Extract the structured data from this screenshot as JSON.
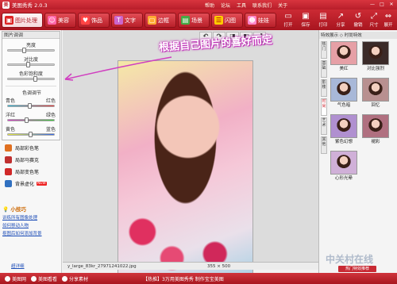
{
  "window": {
    "title": "美图秀秀 2.0.3",
    "menu": [
      "帮助",
      "论坛",
      "工具",
      "联系我们",
      "关于"
    ]
  },
  "tabs": [
    {
      "label": "图片处理",
      "active": true
    },
    {
      "label": "美容",
      "active": false
    },
    {
      "label": "饰品",
      "active": false
    },
    {
      "label": "文字",
      "active": false
    },
    {
      "label": "边框",
      "active": false
    },
    {
      "label": "场景",
      "active": false
    },
    {
      "label": "闪图",
      "active": false
    },
    {
      "label": "娃娃",
      "active": false
    }
  ],
  "toolbar": {
    "open": "打开",
    "save": "保存",
    "print": "打印",
    "share": "分享",
    "revert": "撤销",
    "resize": "尺寸",
    "expand": "展开"
  },
  "left_panel": {
    "adjust_title": "图片调调",
    "brightness": "亮度",
    "brightness_value": 0.35,
    "contrast": "对比度",
    "contrast_value": 0.45,
    "saturation": "色彩饱和度",
    "saturation_value": 0.62,
    "sharpness_title": "色调调节",
    "color_left_1": "青色",
    "color_right_1": "红色",
    "color_value_1": 0.48,
    "color_left_2": "洋红",
    "color_right_2": "绿色",
    "color_value_2": 0.4,
    "color_left_3": "黄色",
    "color_right_3": "蓝色",
    "color_value_3": 0.5,
    "effects": [
      {
        "label": "局部彩色笔",
        "new": false,
        "color": "#e07020"
      },
      {
        "label": "局部马赛克",
        "new": false,
        "color": "#c03030"
      },
      {
        "label": "局部变色笔",
        "new": false,
        "color": "#d02828"
      },
      {
        "label": "背景虚化",
        "new": true,
        "new_label": "NEW",
        "color": "#3070c0"
      }
    ],
    "tips_title": "小技巧",
    "tips": [
      "训练所有图像处理",
      "如何移动人物",
      "抠图后如何添加背景"
    ],
    "help_link": "超详细"
  },
  "canvas": {
    "tools": [
      "撤销",
      "重做",
      "原图",
      "对比",
      "预览"
    ],
    "tool_icons": [
      "undo-icon",
      "redo-icon",
      "original-icon",
      "compare-icon",
      "preview-icon"
    ],
    "filename": "y_large_83kr_27971241022.jpg",
    "dimensions": "355 × 500",
    "annotation": "根据自己图片的喜好而定"
  },
  "right_panel": {
    "header": "特效展示 ◇ 时尚特效",
    "vtabs": [
      "热门",
      "基础",
      "影楼",
      "时尚",
      "艺术",
      "其他"
    ],
    "active_vtab": 3,
    "effects": [
      {
        "label": "美红",
        "color": "#e6a0a6"
      },
      {
        "label": "对比强烈",
        "color": "#3a2a28"
      },
      {
        "label": "气色暗",
        "color": "#a8b8d8"
      },
      {
        "label": "回忆",
        "color": "#b89090"
      },
      {
        "label": "紫色幻想",
        "color": "#b090d0"
      },
      {
        "label": "褪彩",
        "color": "#b07080"
      },
      {
        "label": "心形光晕",
        "color": "#d0b0d8"
      }
    ],
    "footer": "热门特效推荐"
  },
  "bottom_bar": {
    "items": [
      "美图网",
      "美图看看",
      "分享素材"
    ],
    "notice": "【热推】3万用美图秀秀 制作宝宝美图"
  }
}
